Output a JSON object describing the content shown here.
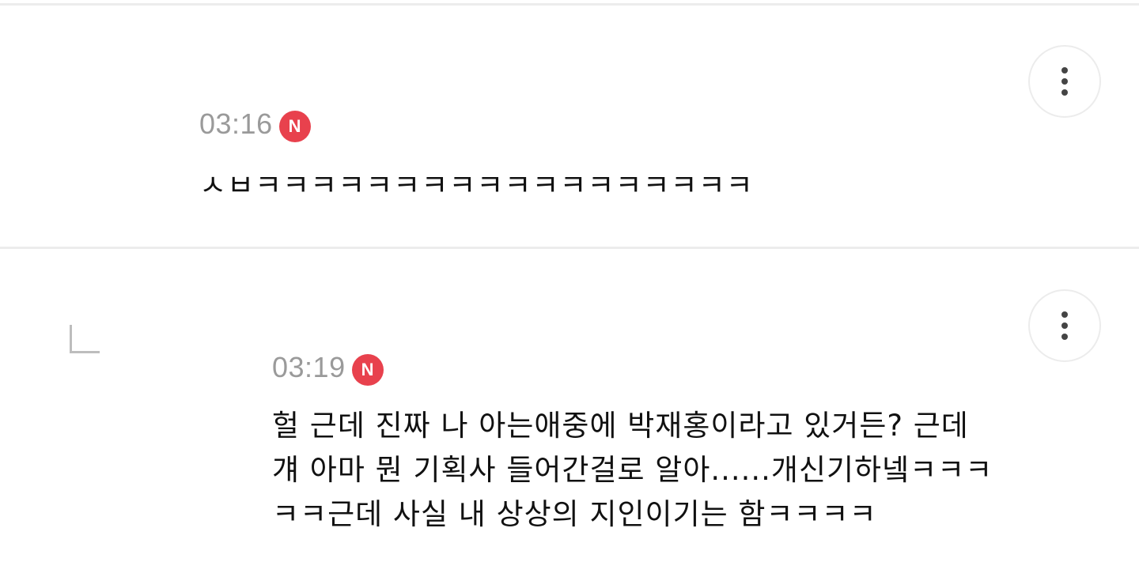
{
  "comments": [
    {
      "time": "03:16",
      "badge": "N",
      "text_lines": [
        "ㅅㅂㅋㅋㅋㅋㅋㅋㅋㅋㅋㅋㅋㅋㅋㅋㅋㅋㅋㅋ"
      ],
      "more_icon": "more-vertical-icon"
    },
    {
      "time": "03:19",
      "badge": "N",
      "is_reply": true,
      "reply_icon": "reply-arrow-icon",
      "text_lines": [
        "헐 근데 진짜 나 아는애중에 박재홍이라고 있거든? 근데",
        "걔 아마 뭔 기획사 들어간걸로 알아......개신기하넼ㅋㅋㅋ",
        "ㅋㅋ근데 사실 내 상상의 지인이기는 함ㅋㅋㅋㅋ"
      ],
      "more_icon": "more-vertical-icon"
    }
  ],
  "colors": {
    "badge": "#e8414d",
    "timestamp": "#9a9a9a",
    "divider": "#ececec",
    "text": "#111111"
  }
}
